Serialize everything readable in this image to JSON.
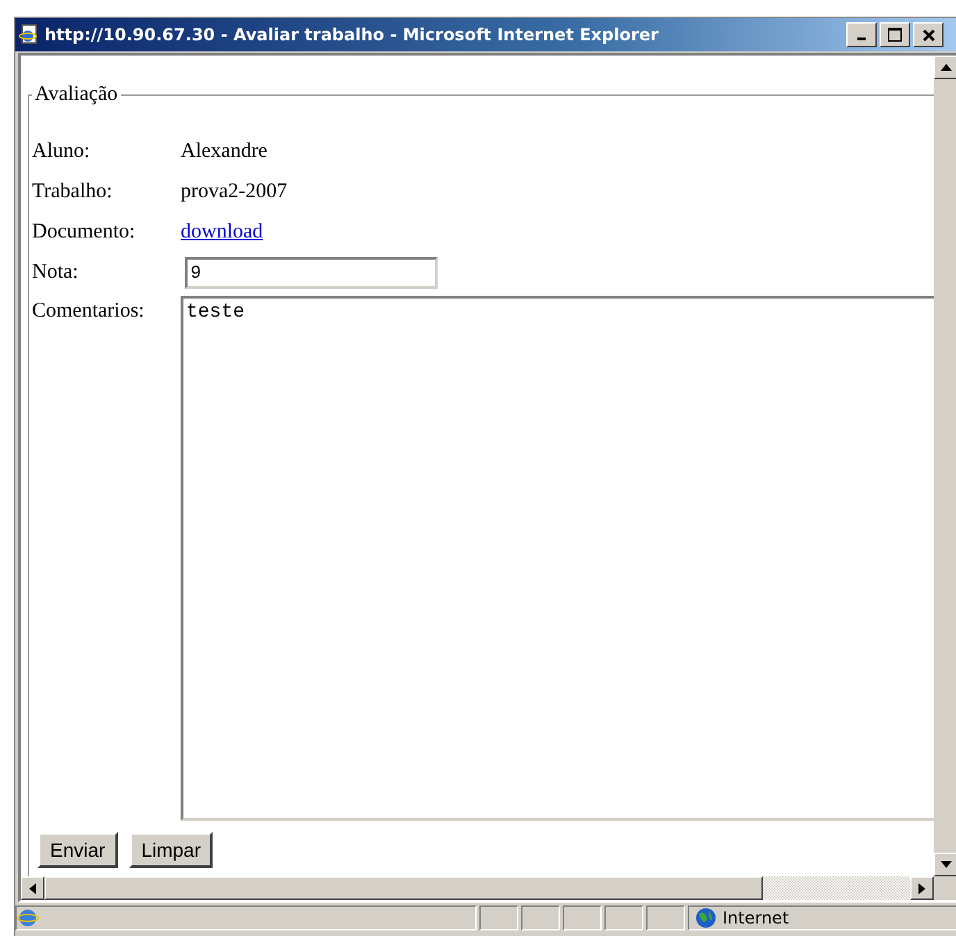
{
  "window": {
    "title": "http://10.90.67.30 - Avaliar trabalho - Microsoft Internet Explorer"
  },
  "form": {
    "legend": "Avaliação",
    "fields": [
      {
        "kind": "text",
        "label": "Aluno:",
        "value": "Alexandre"
      },
      {
        "kind": "text",
        "label": "Trabalho:",
        "value": "prova2-2007"
      },
      {
        "kind": "link",
        "label": "Documento:",
        "value": "download"
      },
      {
        "kind": "input",
        "label": "Nota:",
        "value": "9"
      },
      {
        "kind": "textarea",
        "label": "Comentarios:",
        "value": "teste"
      }
    ],
    "buttons": [
      "Enviar",
      "Limpar"
    ]
  },
  "status_bar": {
    "zone": "Internet"
  }
}
